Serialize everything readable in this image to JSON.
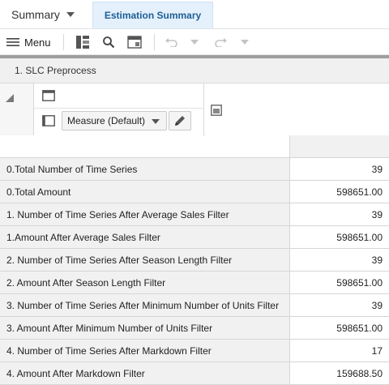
{
  "tabs": {
    "summary_label": "Summary",
    "active_label": "Estimation Summary"
  },
  "toolbar": {
    "menu_label": "Menu",
    "icons": [
      "pivot-icon",
      "search-icon",
      "calculator-icon",
      "undo-icon",
      "redo-icon"
    ]
  },
  "section": {
    "title": "1. SLC Preprocess"
  },
  "pivot": {
    "measure_value": "Measure (Default)"
  },
  "grid": {
    "rows": [
      {
        "label": "0.Total Number of Time Series",
        "value": "39"
      },
      {
        "label": "0.Total Amount",
        "value": "598651.00"
      },
      {
        "label": "1. Number of Time Series After Average Sales Filter",
        "value": "39"
      },
      {
        "label": "1.Amount After Average Sales Filter",
        "value": "598651.00"
      },
      {
        "label": "2. Number of Time Series After Season Length Filter",
        "value": "39"
      },
      {
        "label": "2. Amount After Season Length Filter",
        "value": "598651.00"
      },
      {
        "label": "3. Number of Time Series After Minimum Number of Units Filter",
        "value": "39"
      },
      {
        "label": "3. Amount After Minimum Number of Units Filter",
        "value": "598651.00"
      },
      {
        "label": "4. Number of Time Series After Markdown Filter",
        "value": "17"
      },
      {
        "label": "4. Amount After Markdown Filter",
        "value": "159688.50"
      }
    ]
  },
  "colors": {
    "active_tab_bg": "#e4f0fb",
    "active_tab_text": "#1d5f97",
    "label_cell_bg": "#f1f1f1"
  }
}
